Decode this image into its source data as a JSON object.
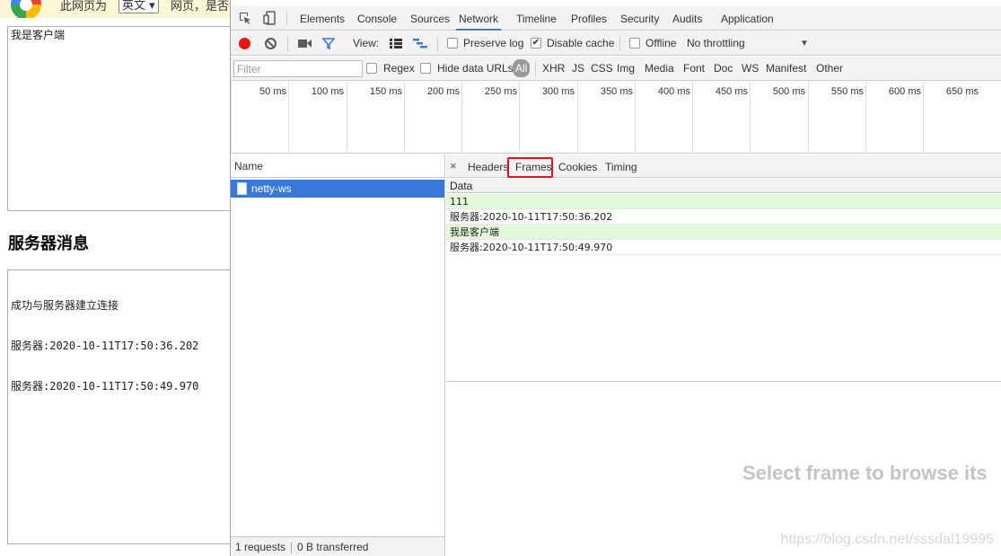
{
  "page": {
    "translate_bar": {
      "text_before": "此网页为",
      "language": "英文",
      "text_after": "网页，是否"
    },
    "client_message": "我是客户端",
    "server_title": "服务器消息",
    "server_log": [
      "成功与服务器建立连接",
      "服务器:2020-10-11T17:50:36.202",
      "服务器:2020-10-11T17:50:49.970"
    ]
  },
  "devtools": {
    "tabs": [
      "Elements",
      "Console",
      "Sources",
      "Network",
      "Timeline",
      "Profiles",
      "Security",
      "Audits",
      "Application"
    ],
    "active_tab": "Network",
    "toolbar": {
      "view_label": "View:",
      "preserve_log": "Preserve log",
      "preserve_log_checked": false,
      "disable_cache": "Disable cache",
      "disable_cache_checked": true,
      "offline": "Offline",
      "offline_checked": false,
      "throttling": "No throttling"
    },
    "filter": {
      "placeholder": "Filter",
      "regex": "Regex",
      "hide_data_urls": "Hide data URLs",
      "types": [
        "All",
        "XHR",
        "JS",
        "CSS",
        "Img",
        "Media",
        "Font",
        "Doc",
        "WS",
        "Manifest",
        "Other"
      ],
      "active_type": "All"
    },
    "timeline_ticks": [
      "50 ms",
      "100 ms",
      "150 ms",
      "200 ms",
      "250 ms",
      "300 ms",
      "350 ms",
      "400 ms",
      "450 ms",
      "500 ms",
      "550 ms",
      "600 ms",
      "650 ms"
    ],
    "requests": {
      "header": "Name",
      "items": [
        "netty-ws"
      ],
      "status_requests": "1 requests",
      "status_transferred": "0 B transferred"
    },
    "detail": {
      "close": "×",
      "tabs": [
        "Headers",
        "Frames",
        "Cookies",
        "Timing"
      ],
      "active_tab": "Frames",
      "column_header": "Data",
      "frames": [
        {
          "data": "111",
          "direction": "sent"
        },
        {
          "data": "服务器:2020-10-11T17:50:36.202",
          "direction": "received"
        },
        {
          "data": "我是客户端",
          "direction": "sent"
        },
        {
          "data": "服务器:2020-10-11T17:50:49.970",
          "direction": "received"
        }
      ],
      "empty_message": "Select frame to browse its"
    }
  },
  "watermark": "https://blog.csdn.net/sssdal19995",
  "colors": {
    "accent_blue": "#3879d9",
    "record_red": "#e81711",
    "highlight_red": "#e0151b",
    "sent_frame_bg": "#e3f9da"
  }
}
